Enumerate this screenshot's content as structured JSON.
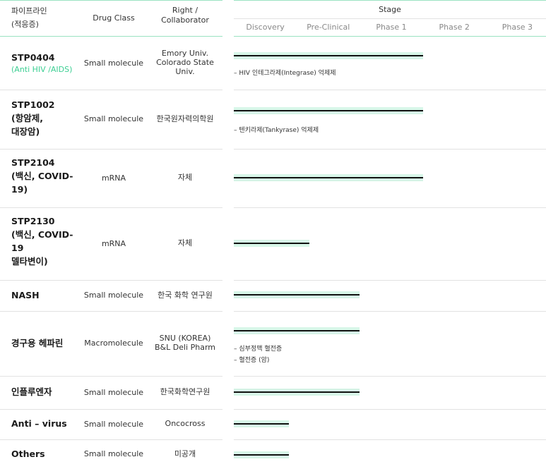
{
  "header": {
    "pipeline_line1": "파이프라인",
    "pipeline_line2": "(적응증)",
    "drug_class": "Drug Class",
    "right_line1": "Right /",
    "right_line2": "Collaborator",
    "stage": "Stage",
    "phases": [
      "Discovery",
      "Pre-Clinical",
      "Phase 1",
      "Phase 2",
      "Phase 3"
    ]
  },
  "rows": [
    {
      "name_lines": [
        "STP0404"
      ],
      "sub": "(Anti HIV /AIDS)",
      "drug_class": "Small molecule",
      "collaborator_lines": [
        "Emory Univ.",
        "Colorado State",
        "Univ."
      ],
      "progress_stage": 3,
      "notes": [
        "HIV 인테그라제(Integrase) 억제제"
      ]
    },
    {
      "name_lines": [
        "STP1002",
        "(항암제,",
        "대장암)"
      ],
      "drug_class": "Small molecule",
      "collaborator_lines": [
        "한국원자력의학원"
      ],
      "progress_stage": 3,
      "notes": [
        "텐키라제(Tankyrase) 억제제"
      ]
    },
    {
      "name_lines": [
        "STP2104",
        "(백신, COVID-",
        "19)"
      ],
      "drug_class": "mRNA",
      "collaborator_lines": [
        "자체"
      ],
      "progress_stage": 3,
      "notes": []
    },
    {
      "name_lines": [
        "STP2130",
        "(백신, COVID-",
        "19",
        "델타변이)"
      ],
      "drug_class": "mRNA",
      "collaborator_lines": [
        "자체"
      ],
      "progress_stage": 1.2,
      "notes": []
    },
    {
      "name_lines": [
        "NASH"
      ],
      "drug_class": "Small molecule",
      "collaborator_lines": [
        "한국 화학 연구원"
      ],
      "progress_stage": 2,
      "notes": []
    },
    {
      "name_lines": [
        "경구용 헤파린"
      ],
      "drug_class": "Macromolecule",
      "collaborator_lines": [
        "SNU (KOREA)",
        "B&L Deli Pharm"
      ],
      "progress_stage": 2,
      "notes": [
        "심부정맥 혈전증",
        "혈전증 (암)"
      ]
    },
    {
      "name_lines": [
        "인플루엔자"
      ],
      "drug_class": "Small molecule",
      "collaborator_lines": [
        "한국화학연구원"
      ],
      "progress_stage": 2,
      "notes": []
    },
    {
      "name_lines": [
        "Anti – virus"
      ],
      "drug_class": "Small molecule",
      "collaborator_lines": [
        "Oncocross"
      ],
      "progress_stage": 0.88,
      "notes": []
    },
    {
      "name_lines": [
        "Others"
      ],
      "drug_class": "Small molecule",
      "collaborator_lines": [
        "미공개"
      ],
      "progress_stage": 0.88,
      "notes": []
    }
  ]
}
